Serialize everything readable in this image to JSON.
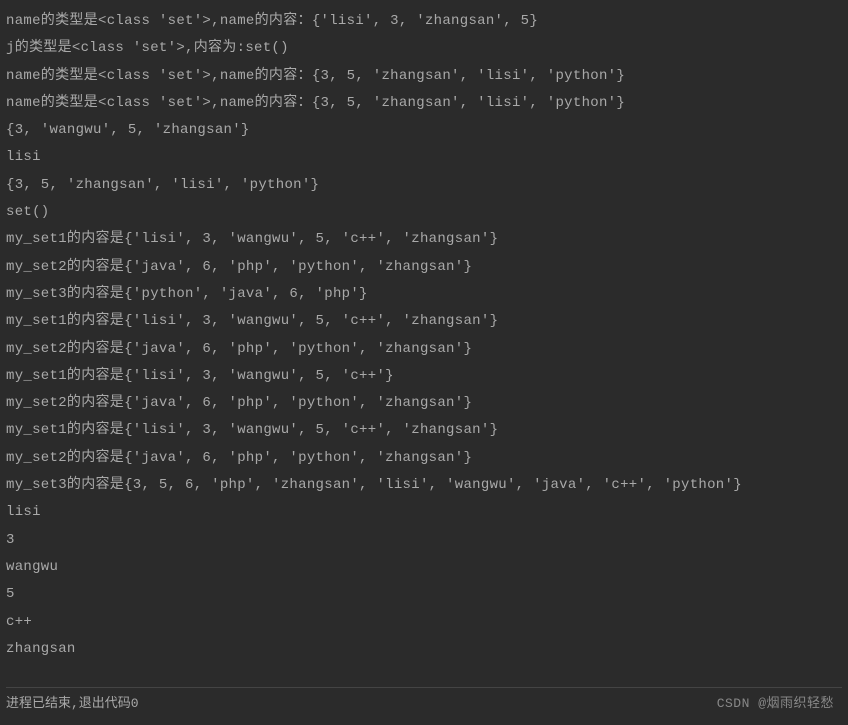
{
  "output": {
    "lines": [
      "name的类型是<class 'set'>,name的内容：{'lisi', 3, 'zhangsan', 5}",
      "j的类型是<class 'set'>,内容为:set()",
      "name的类型是<class 'set'>,name的内容：{3, 5, 'zhangsan', 'lisi', 'python'}",
      "name的类型是<class 'set'>,name的内容：{3, 5, 'zhangsan', 'lisi', 'python'}",
      "{3, 'wangwu', 5, 'zhangsan'}",
      "lisi",
      "{3, 5, 'zhangsan', 'lisi', 'python'}",
      "set()",
      "my_set1的内容是{'lisi', 3, 'wangwu', 5, 'c++', 'zhangsan'}",
      "my_set2的内容是{'java', 6, 'php', 'python', 'zhangsan'}",
      "my_set3的内容是{'python', 'java', 6, 'php'}",
      "my_set1的内容是{'lisi', 3, 'wangwu', 5, 'c++', 'zhangsan'}",
      "my_set2的内容是{'java', 6, 'php', 'python', 'zhangsan'}",
      "my_set1的内容是{'lisi', 3, 'wangwu', 5, 'c++'}",
      "my_set2的内容是{'java', 6, 'php', 'python', 'zhangsan'}",
      "my_set1的内容是{'lisi', 3, 'wangwu', 5, 'c++', 'zhangsan'}",
      "my_set2的内容是{'java', 6, 'php', 'python', 'zhangsan'}",
      "my_set3的内容是{3, 5, 6, 'php', 'zhangsan', 'lisi', 'wangwu', 'java', 'c++', 'python'}",
      "lisi",
      "3",
      "wangwu",
      "5",
      "c++",
      "zhangsan"
    ]
  },
  "footer": {
    "exit_message": "进程已结束,退出代码0",
    "watermark": "CSDN @烟雨织轻愁"
  }
}
